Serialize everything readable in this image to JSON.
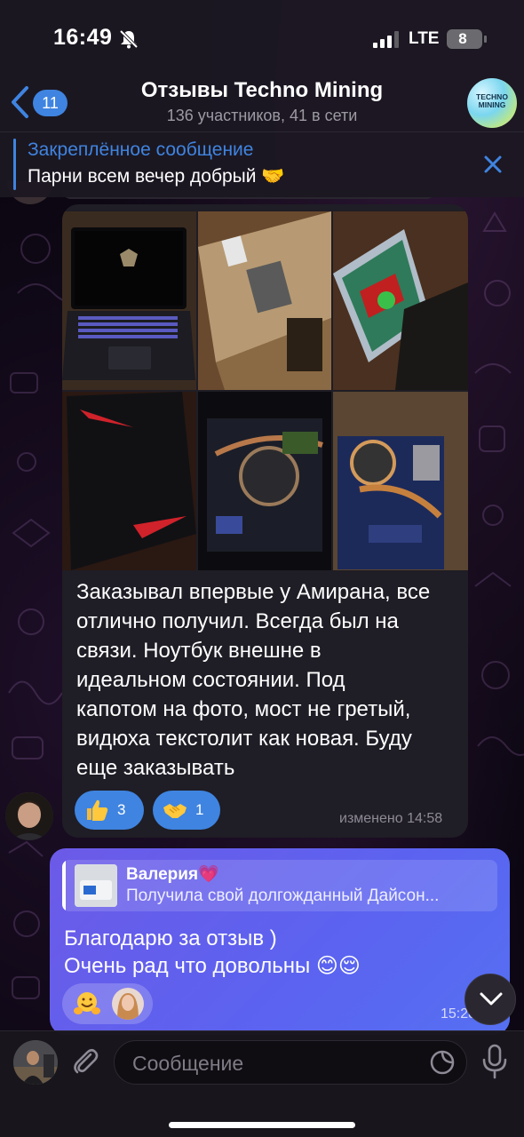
{
  "status_bar": {
    "time": "16:49",
    "network": "LTE",
    "battery": "8"
  },
  "header": {
    "back_count": "11",
    "title": "Отзывы Techno Mining",
    "subtitle": "136 участников, 41 в сети",
    "avatar_text": "TECHNO MINING"
  },
  "pinned": {
    "title": "Закреплённое сообщение",
    "text": "Парни всем вечер добрый 🤝"
  },
  "message_in": {
    "lines": [
      "Заказывал впервые у Амирана, все",
      "отлично получил. Всегда был на",
      "связи. Ноутбук внешне в",
      "идеальном состоянии. Под",
      "капотом на фото, мост не гретый,",
      "видюха текстолит как новая. Буду",
      "еще заказывать"
    ],
    "reactions": [
      {
        "emoji": "thumbs-up",
        "count": "3"
      },
      {
        "emoji": "handshake",
        "count": "1"
      }
    ],
    "time": "изменено 14:58"
  },
  "message_out": {
    "reply_name": "Валерия💗",
    "reply_text": "Получила свой долгожданный Дайсон...",
    "lines": [
      "Благодарю за отзыв )",
      "Очень рад что довольны 😊😌"
    ],
    "time": "15:28"
  },
  "input": {
    "placeholder": "Сообщение"
  },
  "colors": {
    "accent": "#3f84e0",
    "outgoing_bubble": "#5b63f0",
    "incoming_bubble": "#1f1d25"
  }
}
